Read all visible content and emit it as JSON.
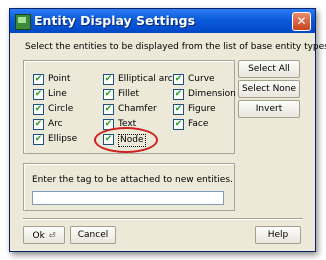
{
  "window": {
    "title": "Entity Display Settings",
    "close_label": "✕"
  },
  "instruction": "Select the entities to be displayed from the list of base entity types.",
  "entities": [
    {
      "label": "Point",
      "checked": true
    },
    {
      "label": "Line",
      "checked": true
    },
    {
      "label": "Circle",
      "checked": true
    },
    {
      "label": "Arc",
      "checked": true
    },
    {
      "label": "Ellipse",
      "checked": true
    },
    {
      "label": "Elliptical arc",
      "checked": true
    },
    {
      "label": "Fillet",
      "checked": true
    },
    {
      "label": "Chamfer",
      "checked": true
    },
    {
      "label": "Text",
      "checked": true
    },
    {
      "label": "Node",
      "checked": true
    },
    {
      "label": "Curve",
      "checked": true
    },
    {
      "label": "Dimension",
      "checked": true
    },
    {
      "label": "Figure",
      "checked": true
    },
    {
      "label": "Face",
      "checked": true
    }
  ],
  "side_buttons": {
    "select_all": "Select All",
    "select_none": "Select None",
    "invert": "Invert"
  },
  "tag": {
    "label": "Enter the tag to be attached to new entities.",
    "value": "",
    "placeholder": ""
  },
  "footer": {
    "ok": "Ok",
    "cancel": "Cancel",
    "help": "Help"
  },
  "checkmark": "✔",
  "colors": {
    "annotation": "#cc2222",
    "titlebar": "#0a5bd8"
  }
}
